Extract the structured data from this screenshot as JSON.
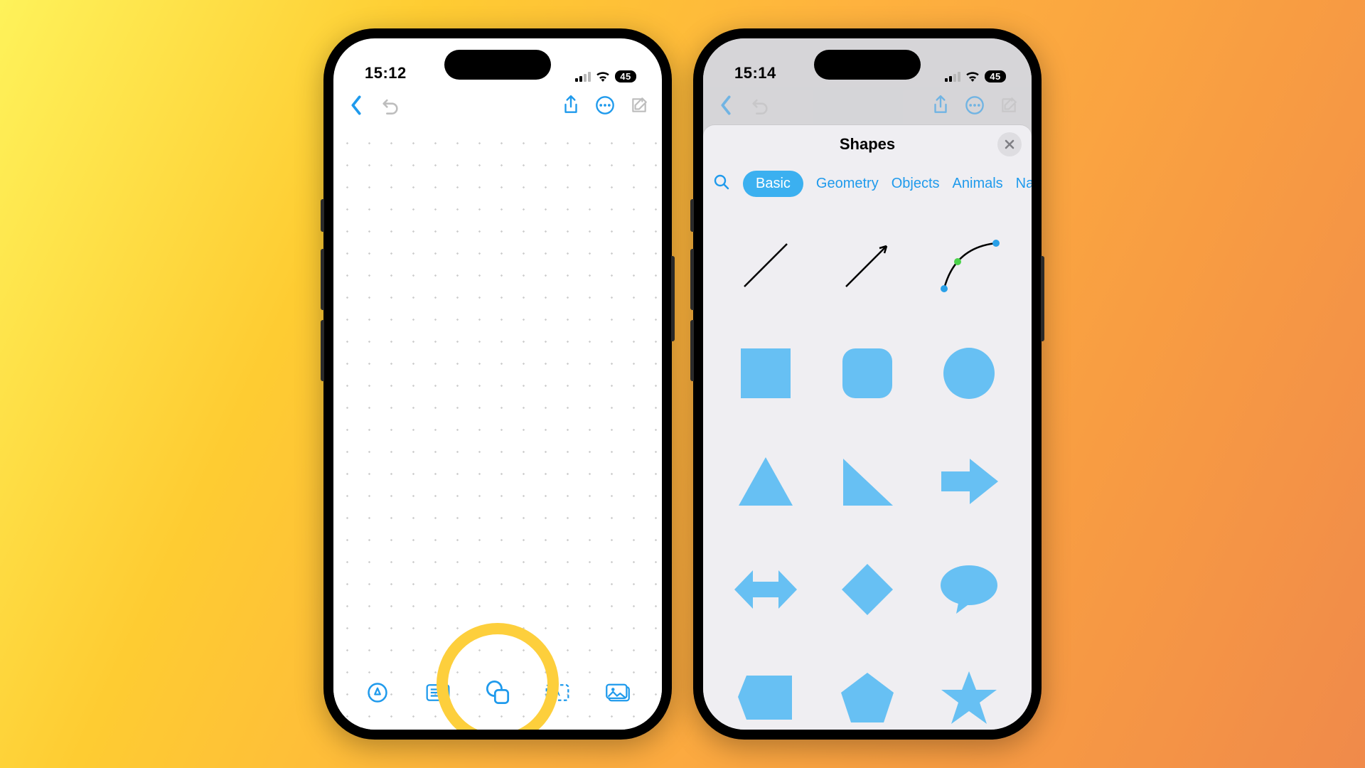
{
  "left_phone": {
    "status": {
      "time": "15:12",
      "battery": "45"
    },
    "toolbar_icons": [
      "back",
      "undo",
      "share",
      "more",
      "compose"
    ],
    "dock_icons": [
      "draw",
      "text-box",
      "shapes",
      "sticky-note",
      "image"
    ]
  },
  "right_phone": {
    "status": {
      "time": "15:14",
      "battery": "45"
    },
    "sheet": {
      "title": "Shapes",
      "categories": [
        "Basic",
        "Geometry",
        "Objects",
        "Animals",
        "Nat"
      ],
      "active_category": "Basic",
      "shapes": [
        "line",
        "arrow-line",
        "curve",
        "square",
        "rounded-square",
        "circle",
        "triangle",
        "right-triangle",
        "arrow-right",
        "arrow-bidir",
        "diamond",
        "speech-bubble",
        "tag",
        "pentagon",
        "star"
      ]
    }
  },
  "colors": {
    "accent": "#1f9aec",
    "shape_fill": "#67c0f3",
    "highlight_ring": "#fdcf3c"
  }
}
